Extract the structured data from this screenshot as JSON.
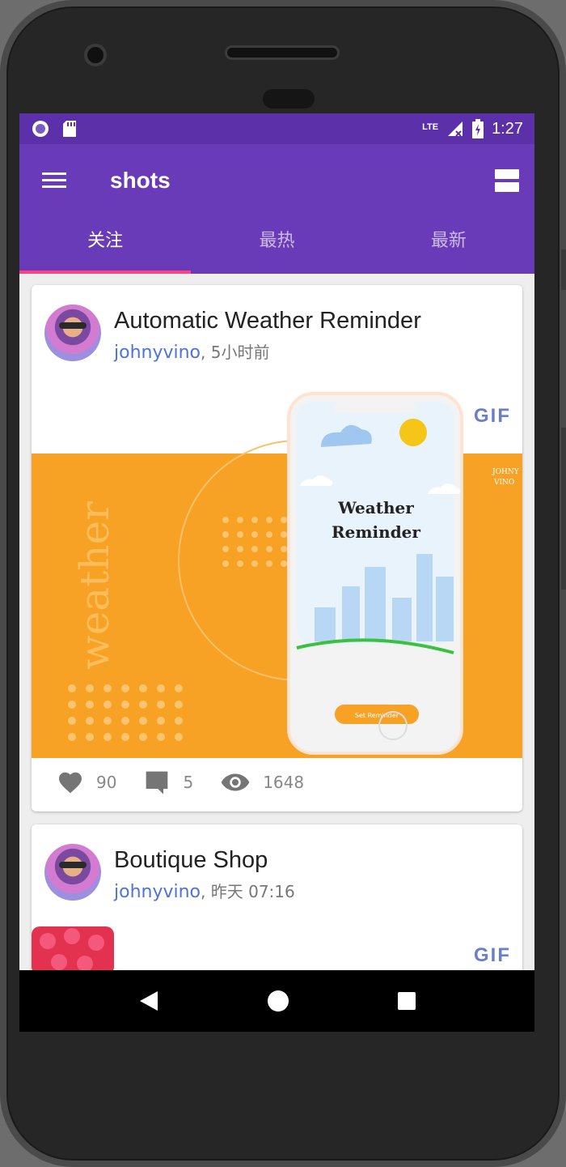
{
  "status_bar": {
    "time": "1:27",
    "network": "LTE",
    "icons": [
      "record-icon",
      "sd-card-icon",
      "signal-icon",
      "battery-icon"
    ]
  },
  "app_bar": {
    "title": "shots",
    "menu_icon": "hamburger-menu-icon",
    "view_icon": "view-agenda-icon"
  },
  "tabs": [
    {
      "label": "关注",
      "active": true
    },
    {
      "label": "最热",
      "active": false
    },
    {
      "label": "最新",
      "active": false
    }
  ],
  "colors": {
    "status_bar": "#5c30a8",
    "primary": "#6a3bb8",
    "tab_indicator": "#ff4081",
    "author_link": "#4e73d9",
    "shot_orange": "#f7a224"
  },
  "shots": [
    {
      "title": "Automatic Weather Reminder",
      "author": "johnyvino",
      "separator": ",",
      "time": "5小时前",
      "badge": "GIF",
      "image_text": {
        "side_word": "weather",
        "phone_title_line1": "Weather",
        "phone_title_line2": "Reminder",
        "phone_button": "Set Reminder",
        "corner_name_1": "JOHNY",
        "corner_name_2": "VINO"
      },
      "likes": "90",
      "comments": "5",
      "views": "1648"
    },
    {
      "title": "Boutique Shop",
      "author": "johnyvino",
      "separator": ",",
      "time": "昨天 07:16",
      "badge": "GIF"
    }
  ]
}
